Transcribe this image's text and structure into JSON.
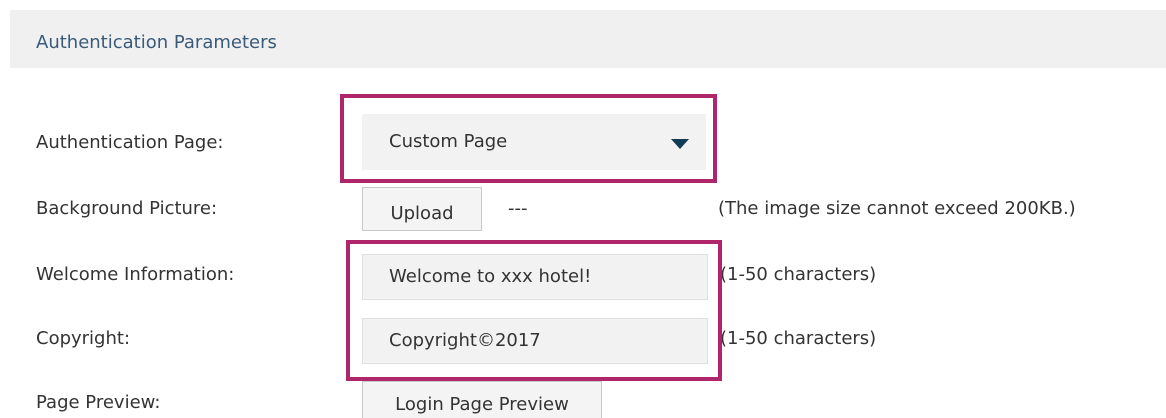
{
  "section": {
    "title": "Authentication Parameters"
  },
  "form": {
    "auth_page": {
      "label": "Authentication Page:",
      "value": "Custom Page"
    },
    "background": {
      "label": "Background Picture:",
      "button_label": "Upload",
      "file_value": "---",
      "note": "(The image size cannot exceed 200KB.)"
    },
    "welcome": {
      "label": "Welcome Information:",
      "value": "Welcome to xxx hotel!",
      "note": "(1-50 characters)"
    },
    "copyright": {
      "label": "Copyright:",
      "value": "Copyright©2017",
      "note": "(1-50 characters)"
    },
    "preview": {
      "label": "Page Preview:",
      "button_label": "Login Page Preview"
    }
  },
  "colors": {
    "highlight": "#b0266a",
    "header_bg": "#f0f0f0",
    "caret": "#123c55"
  },
  "icons": {
    "dropdown": "caret-down-icon"
  }
}
